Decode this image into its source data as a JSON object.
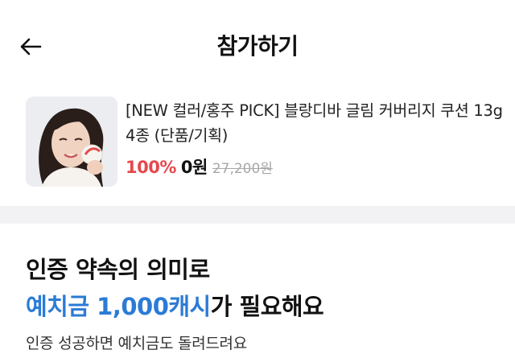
{
  "header": {
    "title": "참가하기",
    "back_icon": "arrow-left-icon"
  },
  "product": {
    "name": "[NEW 컬러/홍주 PICK] 블랑디바 글림 커버리지 쿠션 13g 4종 (단품/기획)",
    "discount": "100%",
    "price": "0원",
    "original_price": "27,200원",
    "colors": {
      "discount": "#e5484d",
      "original": "#a8a8a8"
    }
  },
  "notice": {
    "line1": "인증 약속의 의미로",
    "line2_highlight": "예치금 1,000캐시",
    "line2_rest": "가 필요해요",
    "subtext": "인증 성공하면 예치금도 돌려드려요",
    "accent_color": "#2b7bd6"
  }
}
